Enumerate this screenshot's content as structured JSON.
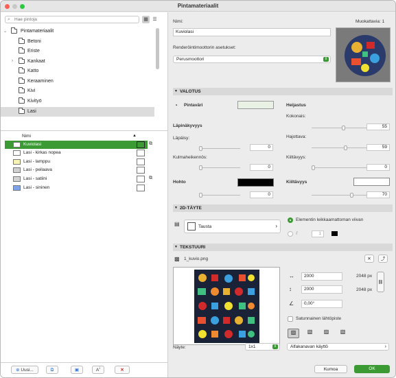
{
  "window": {
    "title": "Pintamateriaalit"
  },
  "left": {
    "search_placeholder": "Hae pintoja",
    "tree": {
      "root": "Pintamateriaalit",
      "folders": [
        "Betoni",
        "Eriste",
        "Kankaat",
        "Katto",
        "Keraaminen",
        "Kivi",
        "Kivityö",
        "Lasi"
      ],
      "selected": "Lasi"
    },
    "list_header": {
      "name": "Nimi",
      "sort": "▲"
    },
    "items": [
      {
        "name": "Kuviolasi",
        "color": "#ffffff",
        "selected": true,
        "texture": true
      },
      {
        "name": "Lasi - kirkas nopea",
        "color": "#ffffff",
        "selected": false,
        "texture": false
      },
      {
        "name": "Lasi - lamppu",
        "color": "#f6f3b4",
        "selected": false,
        "texture": false
      },
      {
        "name": "Lasi - peilaava",
        "color": "#cfcfcf",
        "selected": false,
        "texture": false
      },
      {
        "name": "Lasi - satiini",
        "color": "#d3d3d3",
        "selected": false,
        "texture": true
      },
      {
        "name": "Lasi - sininen",
        "color": "#7ea3e8",
        "selected": false,
        "texture": false
      }
    ],
    "buttons": {
      "new": "Uusi..."
    }
  },
  "right": {
    "name_label": "Nimi:",
    "editable_label": "Muokattavia: 1",
    "name_value": "Kuviolasi",
    "engine_label": "Renderöintimoottorin asetukset:",
    "engine_value": "Perusmoottori",
    "lighting": {
      "title": "VALOTUS",
      "surface_color": "Pintaväri",
      "surface_color_hex": "#e9f1e5",
      "transparency": "Läpinäkyvyys",
      "transmission": "Läpäisy:",
      "transmission_value": "0",
      "falloff": "Kulmaheikennös:",
      "falloff_value": "0",
      "glow": "Hohto",
      "glow_value": "0",
      "reflection": "Heijastus",
      "total": "Kokonais:",
      "total_value": "55",
      "diffuse": "Hajottava:",
      "diffuse_value": "59",
      "gloss": "Kiiltävyys:",
      "gloss_value": "0",
      "shine": "Kiiltävyys",
      "shine_value": "70"
    },
    "fill": {
      "title": "2D-TÄYTE",
      "fill_name": "Tausta",
      "option_cut": "Elementin leikkaamattoman viivan",
      "pen_value": "1"
    },
    "texture": {
      "title": "TEKSTUURI",
      "file": "1_kuvio.png",
      "width": "2000",
      "height": "2000",
      "width_px": "2048 px",
      "height_px": "2048 px",
      "angle": "0,00°",
      "random": "Satunnainen lähtöpiste",
      "sample_label": "Näyte:",
      "sample_value": "1x1",
      "alpha": "Alfakanavan käyttö"
    },
    "buttons": {
      "cancel": "Kumoa",
      "ok": "OK"
    }
  },
  "colors": {
    "accent": "#3c9a34"
  }
}
